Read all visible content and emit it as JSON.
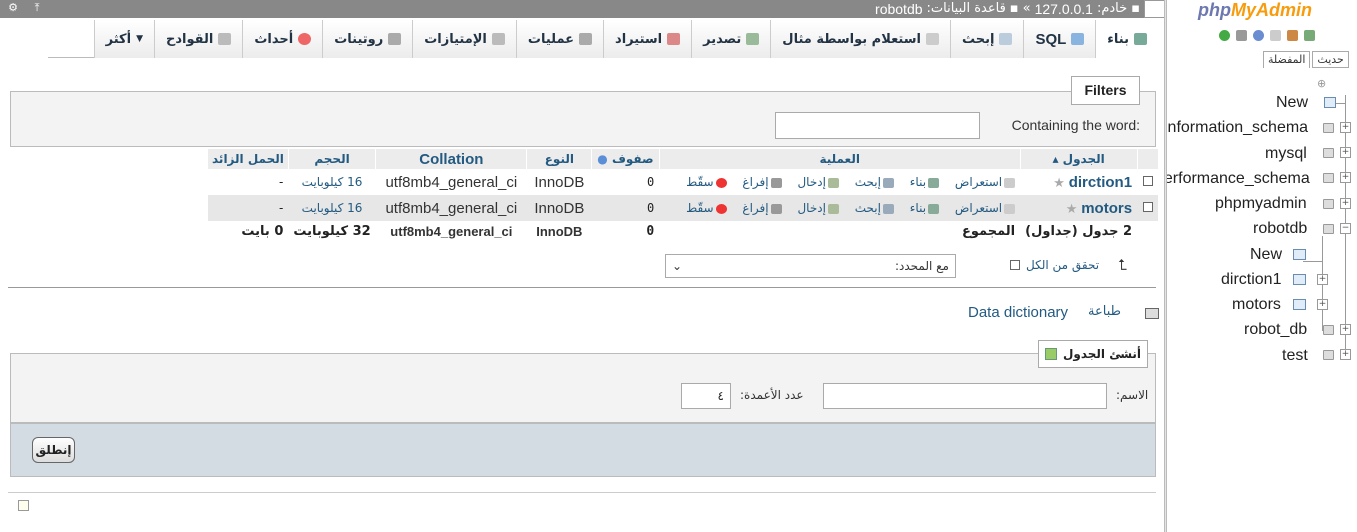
{
  "breadcrumb": {
    "server_label": "خادم:",
    "server_value": "127.0.0.1",
    "separator": "»",
    "db_label": "قاعدة البيانات:",
    "db_value": "robotdb"
  },
  "tabs": [
    {
      "label": "بناء",
      "icon": "structure-icon",
      "active": true
    },
    {
      "label": "SQL",
      "icon": "sql-icon"
    },
    {
      "label": "إبحث",
      "icon": "search-icon"
    },
    {
      "label": "استعلام بواسطة مثال",
      "icon": "query-icon"
    },
    {
      "label": "تصدير",
      "icon": "export-icon"
    },
    {
      "label": "استيراد",
      "icon": "import-icon"
    },
    {
      "label": "عمليات",
      "icon": "wrench-icon"
    },
    {
      "label": "الإمتيازات",
      "icon": "privileges-icon"
    },
    {
      "label": "روتينات",
      "icon": "routines-icon"
    },
    {
      "label": "أحداث",
      "icon": "events-icon"
    },
    {
      "label": "القوادح",
      "icon": "triggers-icon"
    },
    {
      "label": "أكثر",
      "icon": "caret-down-icon"
    }
  ],
  "filters": {
    "legend": "Filters",
    "containing_label": "Containing the word:",
    "input_value": ""
  },
  "table": {
    "headers": {
      "table": "الجدول",
      "action": "العملية",
      "rows": "صفوف",
      "type": "النوع",
      "collation": "Collation",
      "size": "الحجم",
      "overhead": "الحمل الزائد"
    },
    "actions": [
      "استعراض",
      "بناء",
      "إبحث",
      "إدخال",
      "إفراغ",
      "سقّط"
    ],
    "rows": [
      {
        "name": "dirction1",
        "rows": "0",
        "type": "InnoDB",
        "collation": "utf8mb4_general_ci",
        "size": "16 كيلوبايت",
        "overhead": "-"
      },
      {
        "name": "motors",
        "rows": "0",
        "type": "InnoDB",
        "collation": "utf8mb4_general_ci",
        "size": "16 كيلوبايت",
        "overhead": "-"
      }
    ],
    "total": {
      "label": "2 جدول (جداول)",
      "sum_label": "المجموع",
      "rows": "0",
      "type": "InnoDB",
      "collation": "utf8mb4_general_ci",
      "size": "32 كيلوبايت",
      "overhead": "0 بايت"
    }
  },
  "bulk": {
    "check_all": "تحقق من الكل",
    "with_selected": "مع المحدد:"
  },
  "links": {
    "print": "طباعة",
    "data_dictionary": "Data dictionary"
  },
  "create": {
    "legend": "أنشئ الجدول",
    "name_label": "الاسم:",
    "name_value": "",
    "columns_label": "عدد الأعمدة:",
    "columns_value": "٤",
    "go": "إنطلق"
  },
  "nav": {
    "logo_php": "php",
    "logo_my": "MyAdmin",
    "tabs": [
      "حديث",
      "المفضلة"
    ],
    "tree": [
      {
        "label": "New"
      },
      {
        "label": "information_schema"
      },
      {
        "label": "mysql"
      },
      {
        "label": "performance_schema"
      },
      {
        "label": "phpmyadmin"
      },
      {
        "label": "robotdb"
      },
      {
        "label": "New"
      },
      {
        "label": "dirction1"
      },
      {
        "label": "motors"
      },
      {
        "label": "robot_db"
      },
      {
        "label": "test"
      }
    ]
  },
  "colors": {
    "link": "#235a81",
    "topbar": "#888888",
    "panel_bg": "#f3f3f3",
    "foot_bg": "#d3dce3"
  }
}
